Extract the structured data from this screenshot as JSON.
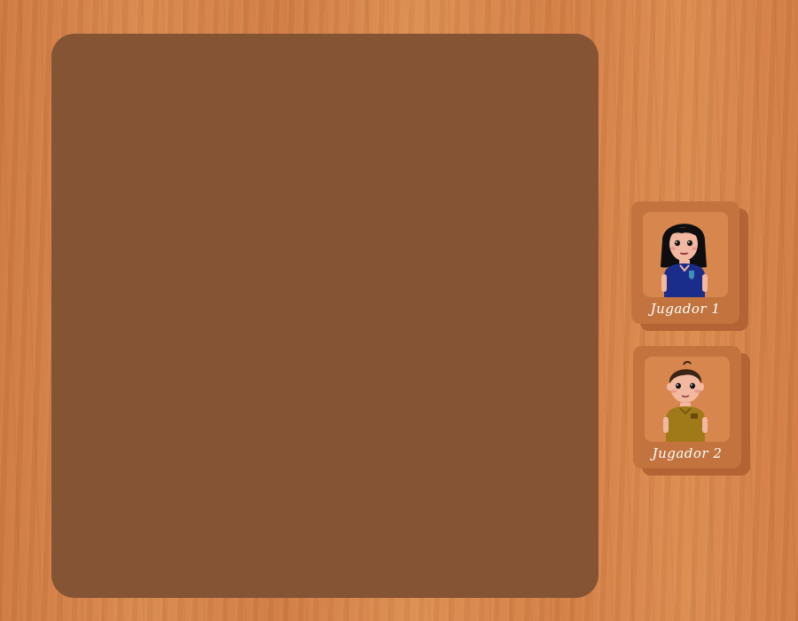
{
  "players": [
    {
      "label": "Jugador 1",
      "avatar_icon": "girl-avatar-icon",
      "shirt_color": "#1a2d8a"
    },
    {
      "label": "Jugador 2",
      "avatar_icon": "boy-avatar-icon",
      "shirt_color": "#a07a18"
    }
  ],
  "colors": {
    "board": "#855434",
    "card": "#c2733e",
    "card_shadow": "#b46434",
    "avatar_bg": "#d7874e"
  }
}
